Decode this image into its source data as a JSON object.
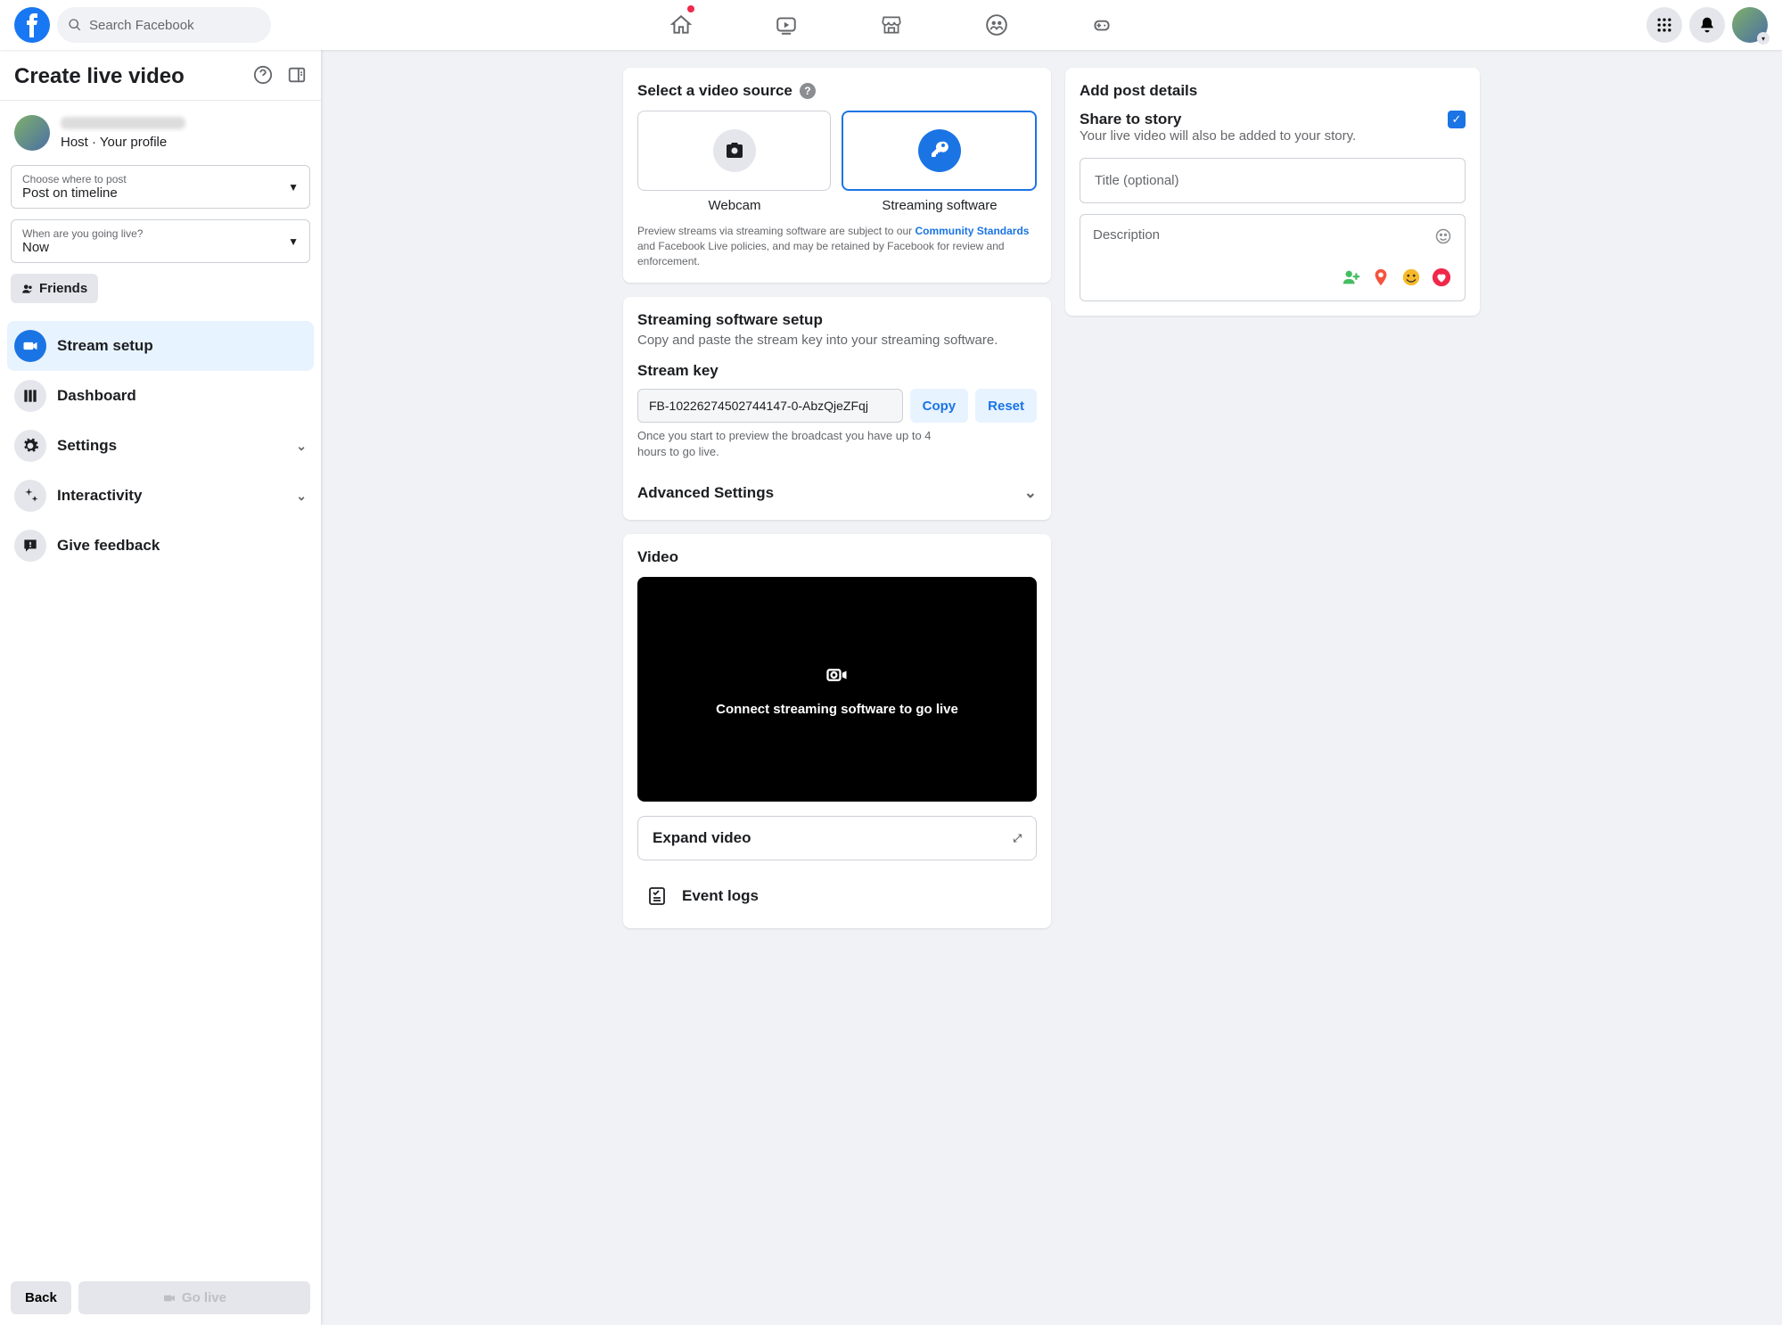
{
  "header": {
    "search_placeholder": "Search Facebook"
  },
  "sidebar": {
    "title": "Create live video",
    "profile_sub": "Host · Your profile",
    "where_label": "Choose where to post",
    "where_value": "Post on timeline",
    "when_label": "When are you going live?",
    "when_value": "Now",
    "friends_label": "Friends",
    "nav": [
      {
        "label": "Stream setup",
        "icon": "camera",
        "active": true
      },
      {
        "label": "Dashboard",
        "icon": "dashboard"
      },
      {
        "label": "Settings",
        "icon": "gear",
        "expandable": true
      },
      {
        "label": "Interactivity",
        "icon": "sparkle",
        "expandable": true
      },
      {
        "label": "Give feedback",
        "icon": "feedback"
      }
    ],
    "back_label": "Back",
    "golive_label": "Go live"
  },
  "main": {
    "source_title": "Select a video source",
    "sources": {
      "webcam_label": "Webcam",
      "software_label": "Streaming software"
    },
    "disclaimer_1": "Preview streams via streaming software are subject to our ",
    "disclaimer_link": "Community Standards",
    "disclaimer_2": " and Facebook Live policies, and may be retained by Facebook for review and enforcement.",
    "stream_title": "Streaming software setup",
    "stream_sub": "Copy and paste the stream key into your streaming software.",
    "streamkey_label": "Stream key",
    "streamkey_value": "FB-10226274502744147-0-AbzQjeZFqj",
    "copy_label": "Copy",
    "reset_label": "Reset",
    "streamkey_note": "Once you start to preview the broadcast you have up to 4 hours to go live.",
    "advanced_label": "Advanced Settings",
    "video_title": "Video",
    "video_connect_text": "Connect streaming software to go live",
    "expand_label": "Expand video",
    "eventlogs_label": "Event logs"
  },
  "details": {
    "title": "Add post details",
    "story_title": "Share to story",
    "story_sub": "Your live video will also be added to your story.",
    "title_placeholder": "Title (optional)",
    "description_placeholder": "Description"
  }
}
